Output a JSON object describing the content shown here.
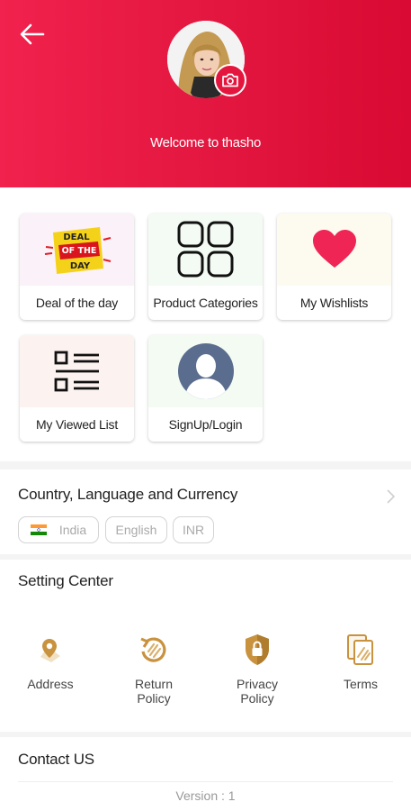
{
  "header": {
    "welcome_text": "Welcome to thasho",
    "back_icon": "arrow-left-icon",
    "camera_icon": "camera-icon",
    "colors": {
      "gradient_start": "#f1224d",
      "gradient_end": "#d90a33"
    }
  },
  "tiles": [
    {
      "label": "Deal of the day",
      "icon": "deal-of-the-day-badge",
      "badge_lines": [
        "DEAL",
        "OF THE",
        "DAY"
      ]
    },
    {
      "label": "Product Categories",
      "icon": "grid-icon"
    },
    {
      "label": "My Wishlists",
      "icon": "heart-icon"
    },
    {
      "label": "My Viewed List",
      "icon": "list-icon"
    },
    {
      "label": "SignUp/Login",
      "icon": "user-avatar-icon"
    }
  ],
  "locale": {
    "title": "Country, Language and Currency",
    "country": "India",
    "language": "English",
    "currency": "INR"
  },
  "settings": {
    "title": "Setting Center",
    "items": [
      {
        "label_lines": [
          "Address"
        ],
        "icon": "location-icon"
      },
      {
        "label_lines": [
          "Return",
          "Policy"
        ],
        "icon": "return-icon"
      },
      {
        "label_lines": [
          "Privacy",
          "Policy"
        ],
        "icon": "lock-shield-icon"
      },
      {
        "label_lines": [
          "Terms"
        ],
        "icon": "document-icon"
      }
    ]
  },
  "contact": {
    "title": "Contact US",
    "version": "Version : 1"
  }
}
